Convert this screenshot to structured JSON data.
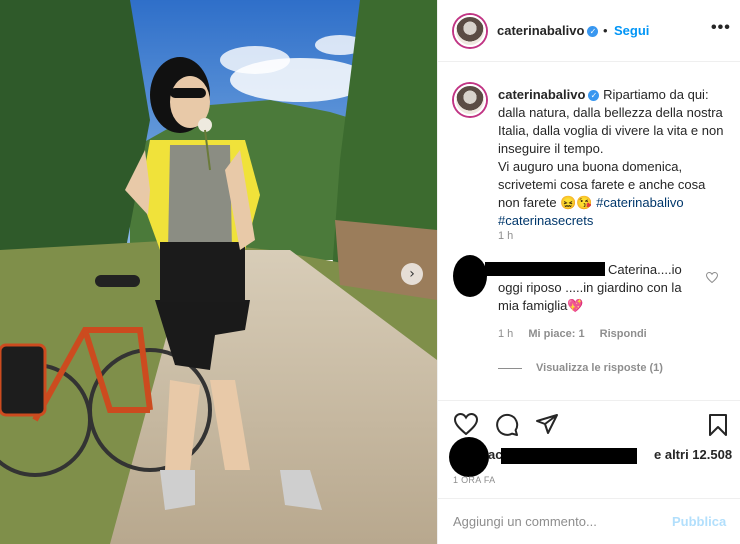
{
  "post": {
    "username": "caterinabalivo",
    "follow_label": "Segui",
    "more_label": "•••",
    "caption_username": "caterinabalivo",
    "caption_text": "Ripartiamo da qui: dalla natura, dalla bellezza della nostra Italia, dalla voglia di vivere la vita e non inseguire il tempo.",
    "caption_text2": "Vi auguro una buona domenica, scrivetemi cosa farete e anche cosa non farete 😖😘",
    "hashtag1": "#caterinabalivo",
    "hashtag2": "#caterinasecrets",
    "caption_time": "1 h"
  },
  "comment": {
    "text_line1": "Caterina....io",
    "text_rest": "oggi riposo .....in giardino con la mia famiglia💖",
    "time": "1 h",
    "likes": "Mi piace: 1",
    "reply": "Rispondi",
    "view_replies": "Visualizza le risposte (1)"
  },
  "likes": {
    "prefix": "ac",
    "suffix": "e altri 12.508"
  },
  "post_time": "1 ORA FA",
  "add_comment": {
    "placeholder": "Aggiungi un commento...",
    "publish": "Pubblica"
  },
  "colors": {
    "accent": "#0095f6",
    "text": "#262626",
    "muted": "#8e8e8e",
    "publish_disabled": "#b2dffc",
    "hashtag": "#00376b"
  },
  "icons": [
    "verified-icon",
    "heart-icon",
    "comment-icon",
    "share-icon",
    "bookmark-icon",
    "chevron-right-icon",
    "more-icon"
  ]
}
